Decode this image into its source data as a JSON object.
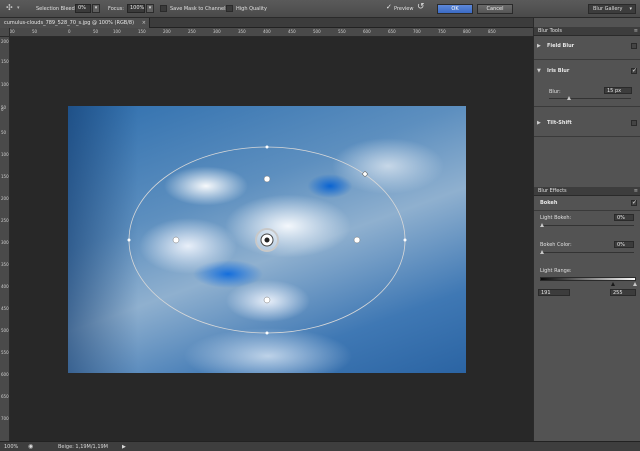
{
  "options_bar": {
    "selection_bleed_label": "Selection Bleed:",
    "selection_bleed_value": "0%",
    "focus_label": "Focus:",
    "focus_value": "100%",
    "save_mask_label": "Save Mask to Channels",
    "high_quality_label": "High Quality",
    "preview_label": "Preview",
    "preview_checked": true,
    "ok_label": "OK",
    "cancel_label": "Cancel",
    "workspace_label": "Blur Gallery"
  },
  "document": {
    "tab_title": "cumulus-clouds_789_528_70_s.jpg @ 100% (RGB/8)",
    "close_glyph": "×"
  },
  "rulers": {
    "horizontal_ticks": [
      "100",
      "50",
      "0",
      "50",
      "100",
      "150",
      "200",
      "250",
      "300",
      "350",
      "400",
      "450",
      "500",
      "550",
      "600",
      "650",
      "700",
      "750",
      "800",
      "850"
    ],
    "vertical_ticks": [
      "200",
      "150",
      "100",
      "50",
      "0",
      "50",
      "100",
      "150",
      "200",
      "250",
      "300",
      "350",
      "400",
      "450",
      "500",
      "550",
      "600",
      "650",
      "700"
    ]
  },
  "blur_tools": {
    "header": "Blur Tools",
    "field_blur_label": "Field Blur",
    "field_blur_checked": false,
    "iris_blur_label": "Iris Blur",
    "iris_blur_checked": true,
    "blur_label": "Blur:",
    "blur_value": "15 px",
    "blur_slider_fraction": 0.25,
    "tilt_shift_label": "Tilt-Shift",
    "tilt_shift_checked": false
  },
  "blur_effects": {
    "header": "Blur Effects",
    "bokeh_label": "Bokeh",
    "bokeh_checked": true,
    "light_bokeh_label": "Light Bokeh:",
    "light_bokeh_value": "0%",
    "light_bokeh_fraction": 0.0,
    "bokeh_color_label": "Bokeh Color:",
    "bokeh_color_value": "0%",
    "bokeh_color_fraction": 0.0,
    "light_range_label": "Light Range:",
    "light_range_low": "191",
    "light_range_high": "255"
  },
  "status_bar": {
    "zoom": "100%",
    "info": "Beige: 1,19M/1,19M",
    "arrow_glyph": "▶"
  }
}
